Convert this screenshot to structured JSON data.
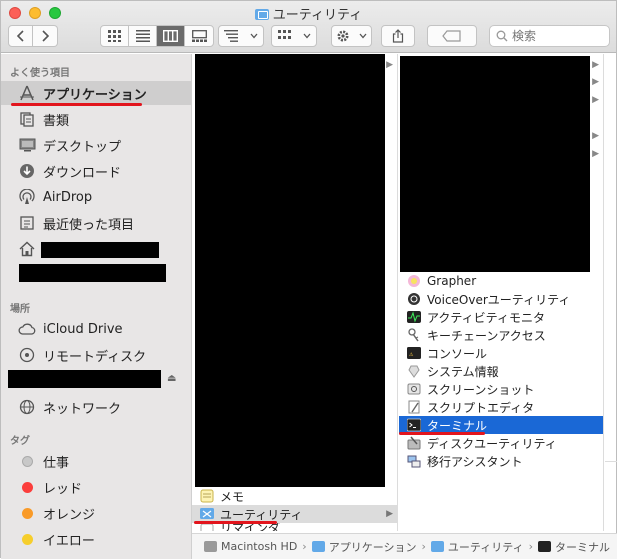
{
  "window": {
    "title": "ユーティリティ"
  },
  "toolbar": {
    "search_placeholder": "検索"
  },
  "sidebar": {
    "favorites_header": "よく使う項目",
    "favorites": [
      {
        "label": "アプリケーション",
        "icon": "applications-icon"
      },
      {
        "label": "書類",
        "icon": "documents-icon"
      },
      {
        "label": "デスクトップ",
        "icon": "desktop-icon"
      },
      {
        "label": "ダウンロード",
        "icon": "downloads-icon"
      },
      {
        "label": "AirDrop",
        "icon": "airdrop-icon"
      },
      {
        "label": "最近使った項目",
        "icon": "recents-icon"
      }
    ],
    "locations_header": "場所",
    "locations": [
      {
        "label": "iCloud Drive",
        "icon": "cloud-icon"
      },
      {
        "label": "リモートディスク",
        "icon": "remote-disc-icon"
      },
      {
        "label": "ネットワーク",
        "icon": "network-icon"
      }
    ],
    "tags_header": "タグ",
    "tags": [
      {
        "label": "仕事",
        "color": "#c8c8c8"
      },
      {
        "label": "レッド",
        "color": "#fb3e3c"
      },
      {
        "label": "オレンジ",
        "color": "#f99a28"
      },
      {
        "label": "イエロー",
        "color": "#f6ce2c"
      }
    ]
  },
  "column1": {
    "items": [
      {
        "label": "メモ"
      },
      {
        "label": "ユーティリティ"
      },
      {
        "label": "リマインダ"
      }
    ]
  },
  "column2": {
    "items": [
      {
        "label": "Grapher"
      },
      {
        "label": "VoiceOverユーティリティ"
      },
      {
        "label": "アクティビティモニタ"
      },
      {
        "label": "キーチェーンアクセス"
      },
      {
        "label": "コンソール"
      },
      {
        "label": "システム情報"
      },
      {
        "label": "スクリーンショット"
      },
      {
        "label": "スクリプトエディタ"
      },
      {
        "label": "ターミナル"
      },
      {
        "label": "ディスクユーティリティ"
      },
      {
        "label": "移行アシスタント"
      }
    ]
  },
  "pathbar": {
    "segments": [
      "Macintosh HD",
      "アプリケーション",
      "ユーティリティ",
      "ターミナル"
    ]
  },
  "colors": {
    "selection": "#1a68d6",
    "annotation": "#e2151d"
  }
}
